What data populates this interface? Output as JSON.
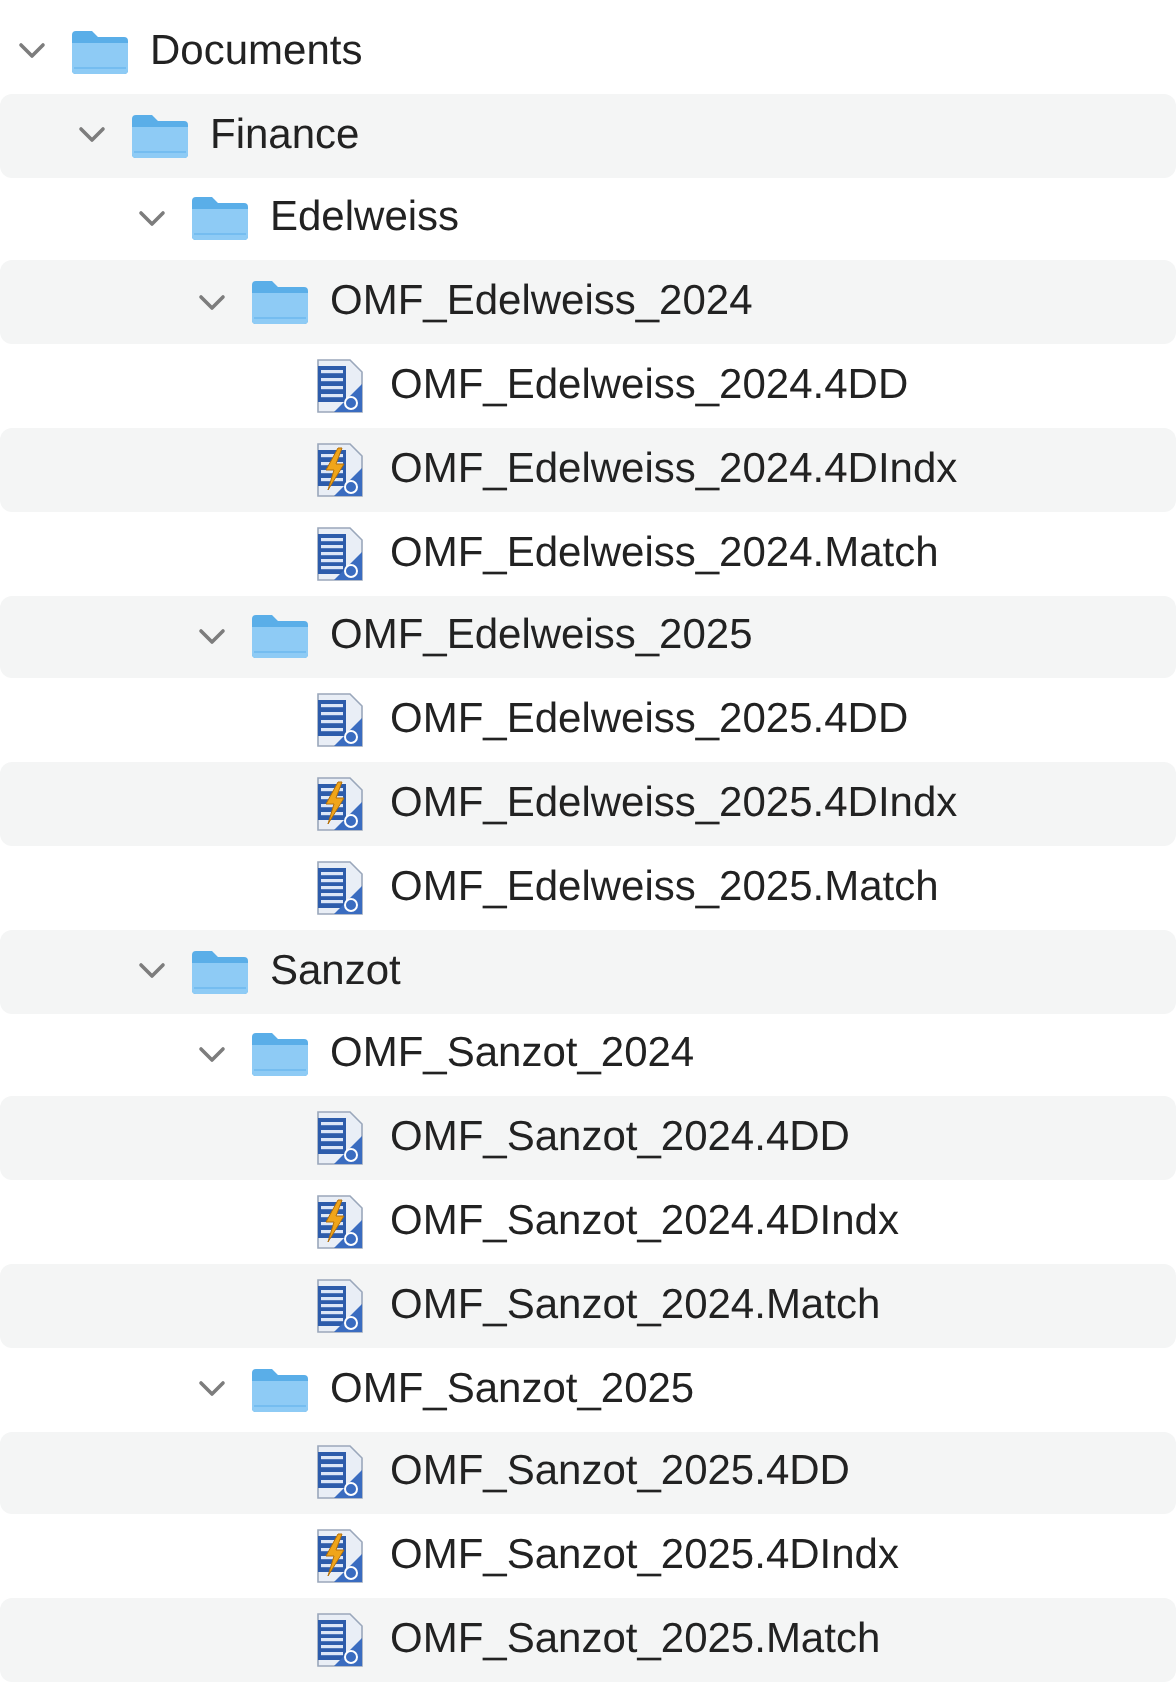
{
  "tree": [
    {
      "name": "Documents",
      "kind": "folder",
      "expanded": true,
      "children": [
        {
          "name": "Finance",
          "kind": "folder",
          "expanded": true,
          "children": [
            {
              "name": "Edelweiss",
              "kind": "folder",
              "expanded": true,
              "children": [
                {
                  "name": "OMF_Edelweiss_2024",
                  "kind": "folder",
                  "expanded": true,
                  "children": [
                    {
                      "name": "OMF_Edelweiss_2024.4DD",
                      "kind": "data"
                    },
                    {
                      "name": "OMF_Edelweiss_2024.4DIndx",
                      "kind": "index"
                    },
                    {
                      "name": "OMF_Edelweiss_2024.Match",
                      "kind": "match"
                    }
                  ]
                },
                {
                  "name": "OMF_Edelweiss_2025",
                  "kind": "folder",
                  "expanded": true,
                  "children": [
                    {
                      "name": "OMF_Edelweiss_2025.4DD",
                      "kind": "data"
                    },
                    {
                      "name": "OMF_Edelweiss_2025.4DIndx",
                      "kind": "index"
                    },
                    {
                      "name": "OMF_Edelweiss_2025.Match",
                      "kind": "match"
                    }
                  ]
                }
              ]
            },
            {
              "name": "Sanzot",
              "kind": "folder",
              "expanded": true,
              "children": [
                {
                  "name": "OMF_Sanzot_2024",
                  "kind": "folder",
                  "expanded": true,
                  "children": [
                    {
                      "name": "OMF_Sanzot_2024.4DD",
                      "kind": "data"
                    },
                    {
                      "name": "OMF_Sanzot_2024.4DIndx",
                      "kind": "index"
                    },
                    {
                      "name": "OMF_Sanzot_2024.Match",
                      "kind": "match"
                    }
                  ]
                },
                {
                  "name": "OMF_Sanzot_2025",
                  "kind": "folder",
                  "expanded": true,
                  "children": [
                    {
                      "name": "OMF_Sanzot_2025.4DD",
                      "kind": "data"
                    },
                    {
                      "name": "OMF_Sanzot_2025.4DIndx",
                      "kind": "index"
                    },
                    {
                      "name": "OMF_Sanzot_2025.Match",
                      "kind": "match"
                    }
                  ]
                }
              ]
            }
          ]
        }
      ]
    }
  ]
}
